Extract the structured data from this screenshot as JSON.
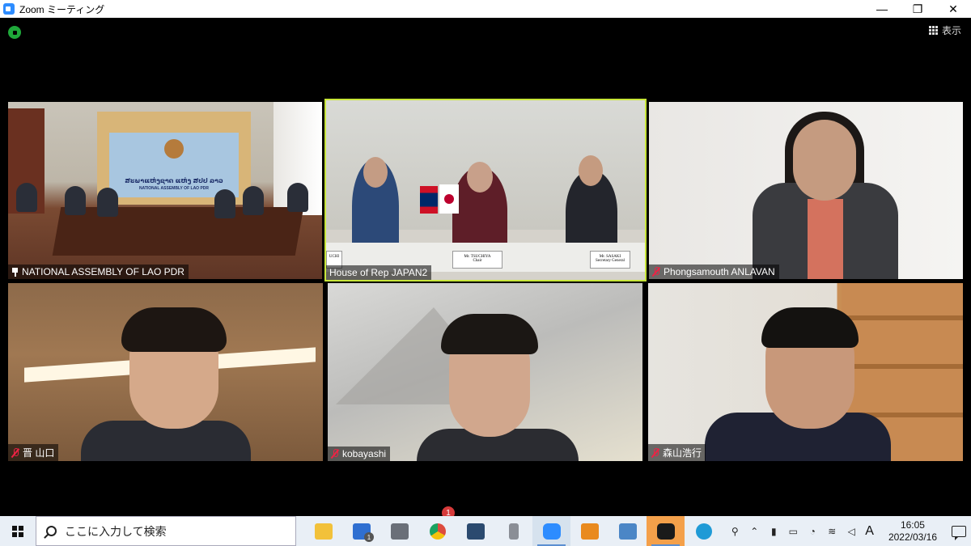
{
  "window": {
    "title": "Zoom ミーティング",
    "controls": {
      "minimize": "—",
      "restore": "❐",
      "close": "✕"
    }
  },
  "toolbar": {
    "view_label": "表示"
  },
  "tiles": [
    {
      "name": "NATIONAL ASSEMBLY OF LAO PDR",
      "status_icon": "pin-icon",
      "banner_line1": "ສະພາແຫ່ງຊາດ ແຫ່ງ ສປປ ລາວ",
      "banner_line2": "NATIONAL ASSEMBLY OF LAO PDR"
    },
    {
      "name": "House of Rep JAPAN2",
      "status_icon": "none",
      "active_speaker": true,
      "placards": [
        "UCHI",
        "Mr. TSUCHIYA",
        "Chair",
        "Mr. SASAKI",
        "Secretary General"
      ]
    },
    {
      "name": "Phongsamouth ANLAVAN",
      "status_icon": "mic-off-icon"
    },
    {
      "name": "晋 山口",
      "status_icon": "mic-off-icon"
    },
    {
      "name": "kobayashi",
      "status_icon": "mic-off-icon"
    },
    {
      "name": "森山浩行",
      "status_icon": "mic-off-icon"
    }
  ],
  "taskbar": {
    "search_placeholder": "ここに入力して検索",
    "apps": [
      {
        "icon": "file-explorer-icon",
        "color": "#f2c13a"
      },
      {
        "icon": "mail-icon",
        "color": "#2f6fd1",
        "badge": "1"
      },
      {
        "icon": "network-drive-icon",
        "color": "#6a6f78"
      },
      {
        "icon": "chrome-icon",
        "color": "#dd4b3e"
      },
      {
        "icon": "app-blue-diamond-icon",
        "color": "#2b4a6f"
      },
      {
        "icon": "microphone-app-icon",
        "color": "#8a8e96"
      },
      {
        "icon": "zoom-icon",
        "color": "#2d8cff",
        "active": true
      },
      {
        "icon": "orange-app-icon",
        "color": "#e98a1e"
      },
      {
        "icon": "laptop-app-icon",
        "color": "#4b86c6"
      },
      {
        "icon": "webex-icon",
        "color": "#f08c21",
        "active": true
      },
      {
        "icon": "edge-icon",
        "color": "#1f9ad6"
      }
    ],
    "notification_badge": "1",
    "ime": "A",
    "time": "16:05",
    "date": "2022/03/16"
  }
}
